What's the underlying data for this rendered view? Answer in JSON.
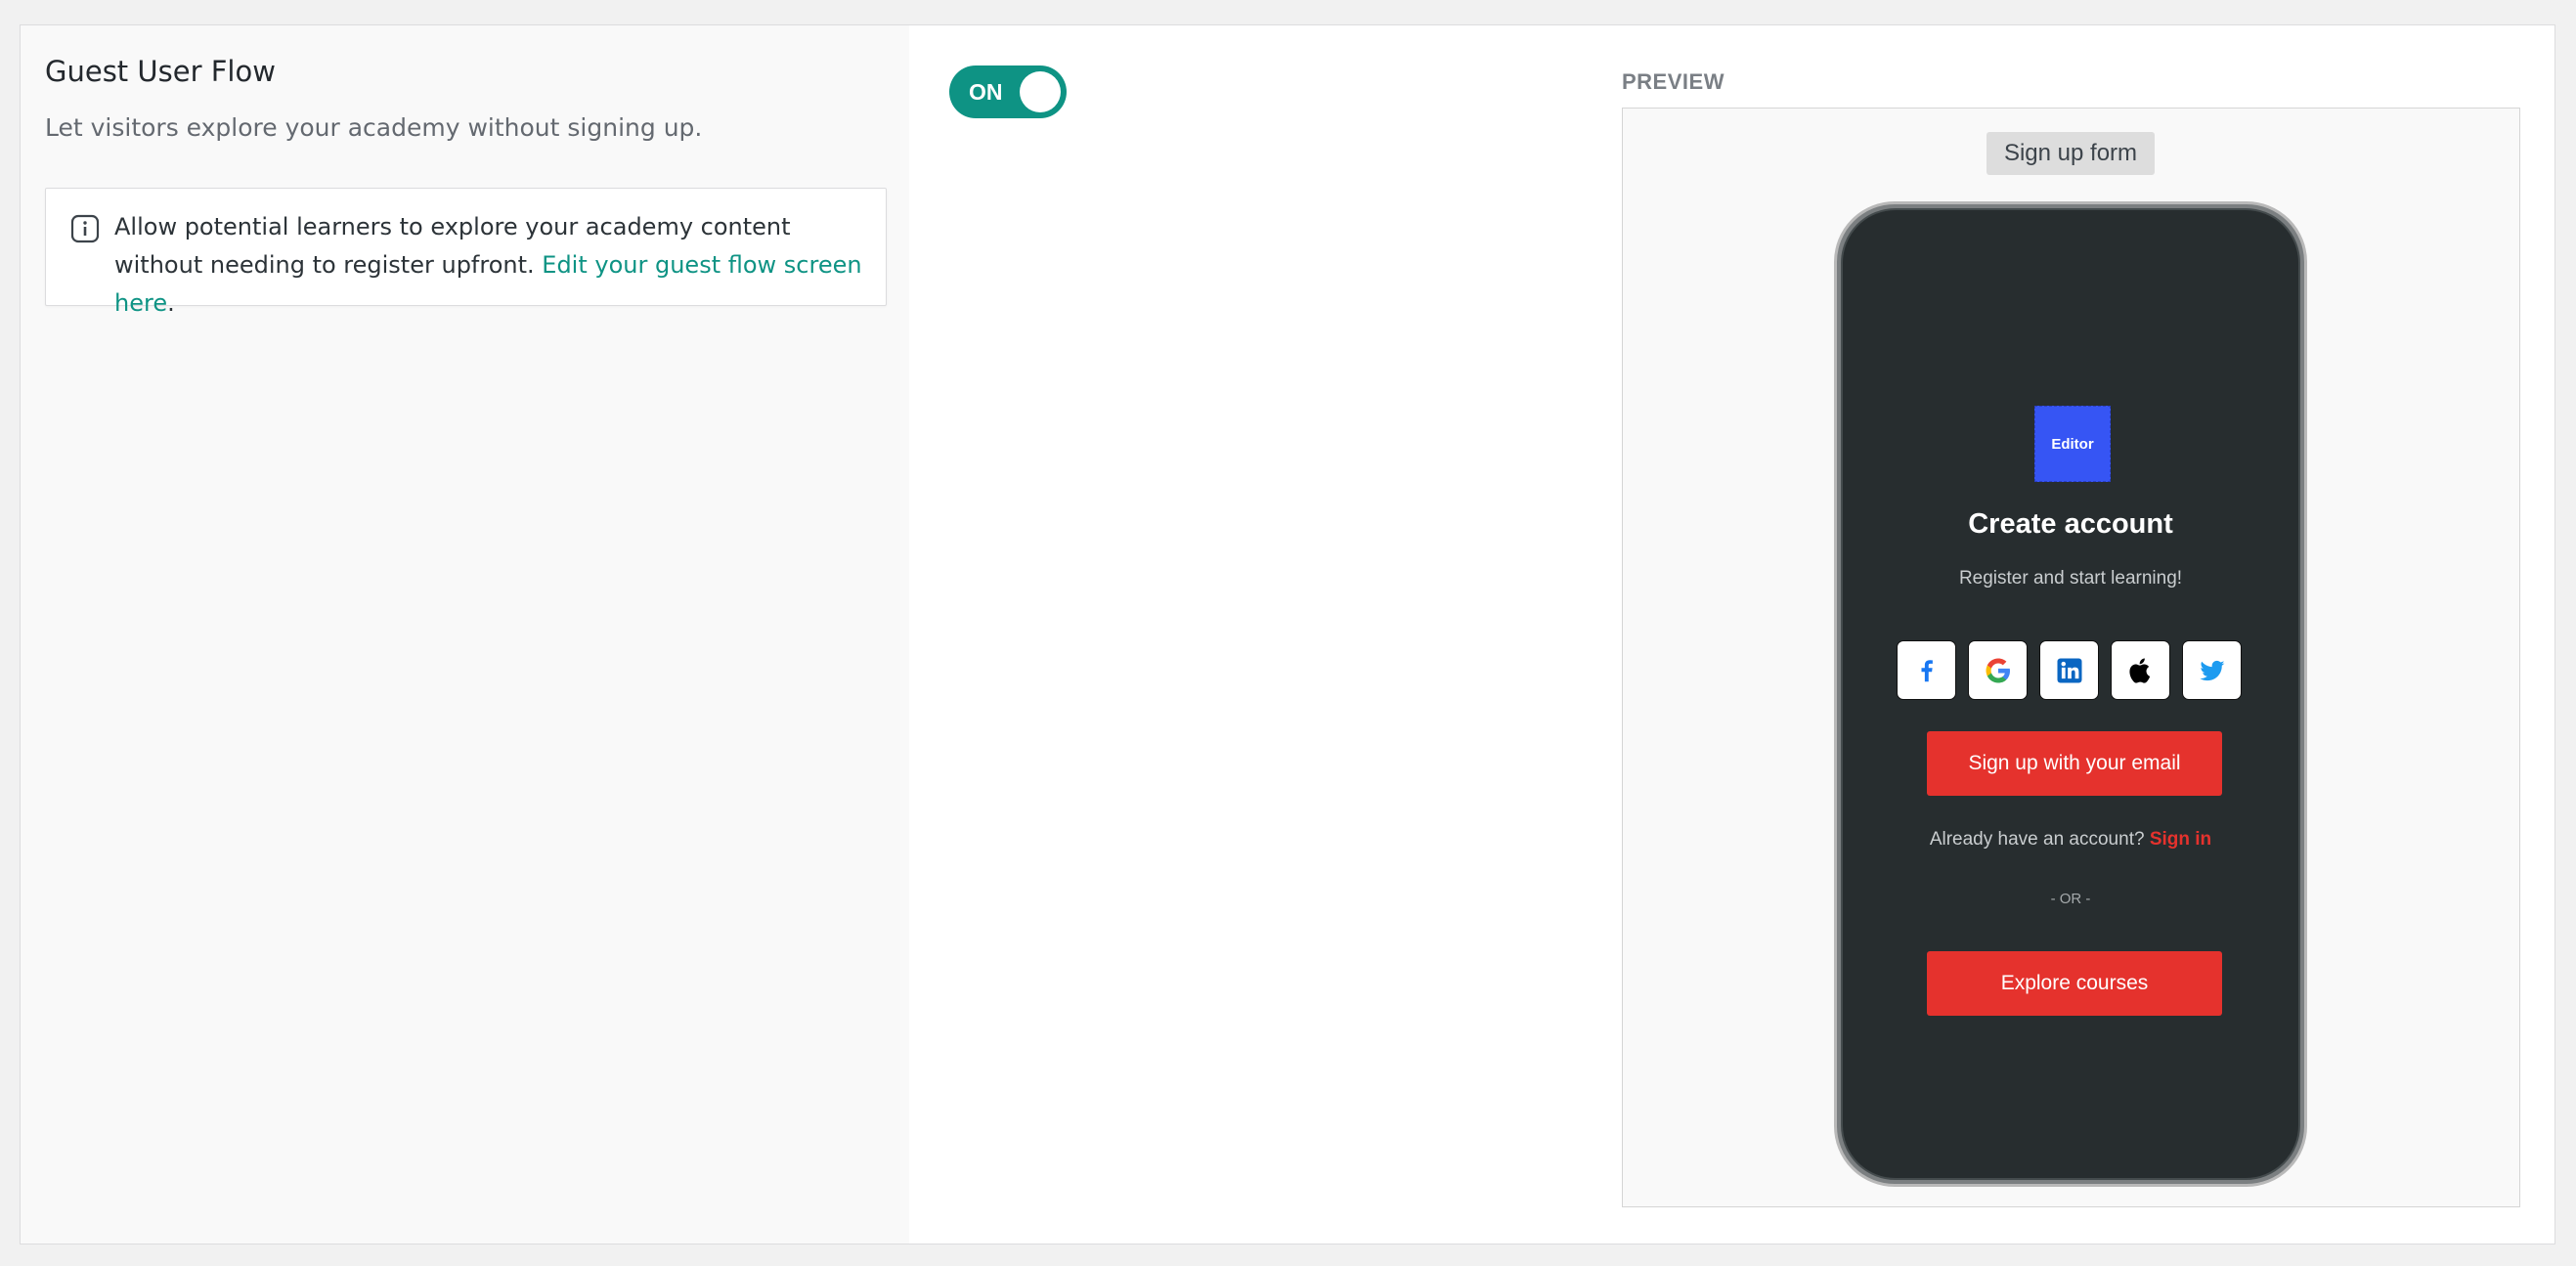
{
  "section": {
    "title": "Guest User Flow",
    "description": "Let visitors explore your academy without signing up.",
    "info": {
      "icon": "info-icon",
      "text": "Allow potential learners to explore your academy content without needing to register upfront. ",
      "link_text": "Edit your guest flow screen here",
      "trailing": "."
    }
  },
  "toggle": {
    "label": "ON",
    "state": "on",
    "color": "#0e9384"
  },
  "preview": {
    "label": "PREVIEW",
    "tag": "Sign up form",
    "phone": {
      "logo_text": "Editor",
      "title": "Create account",
      "subtitle": "Register and start learning!",
      "social": [
        {
          "name": "facebook-icon"
        },
        {
          "name": "google-icon"
        },
        {
          "name": "linkedin-icon"
        },
        {
          "name": "apple-icon"
        },
        {
          "name": "twitter-icon"
        }
      ],
      "email_button": "Sign up with your email",
      "signin_prompt": "Already have an account?",
      "signin_link": "Sign in",
      "or_text": "- OR -",
      "explore_button": "Explore courses"
    }
  },
  "colors": {
    "accent": "#0e9384",
    "danger": "#e5322d",
    "logo": "#3655f4",
    "phone_bg": "#272d2f"
  }
}
